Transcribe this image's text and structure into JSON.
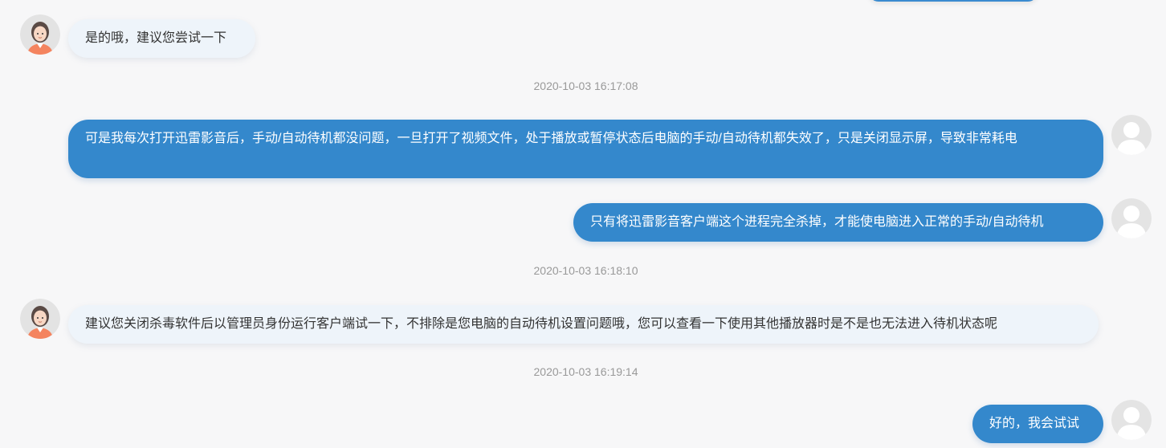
{
  "messages": [
    {
      "sender": "agent",
      "text": "是的哦，建议您尝试一下"
    },
    {
      "sender": "user",
      "text": "可是我每次打开迅雷影音后，手动/自动待机都没问题，一旦打开了视频文件，处于播放或暂停状态后电脑的手动/自动待机都失效了，只是关闭显示屏，导致非常耗电"
    },
    {
      "sender": "user",
      "text": "只有将迅雷影音客户端这个进程完全杀掉，才能使电脑进入正常的手动/自动待机"
    },
    {
      "sender": "agent",
      "text": "建议您关闭杀毒软件后以管理员身份运行客户端试一下，不排除是您电脑的自动待机设置问题哦，您可以查看一下使用其他播放器时是不是也无法进入待机状态呢"
    },
    {
      "sender": "user",
      "text": "好的，我会试试"
    }
  ],
  "timestamps": [
    "2020-10-03 16:17:08",
    "2020-10-03 16:18:10",
    "2020-10-03 16:19:14"
  ],
  "colors": {
    "background": "#f7f7f8",
    "user_bubble": "#3488cc",
    "agent_bubble": "#eef4fa",
    "timestamp_text": "#999999"
  },
  "icons": {
    "agent_avatar": "female-agent-avatar-icon",
    "user_avatar": "default-user-avatar-icon"
  }
}
